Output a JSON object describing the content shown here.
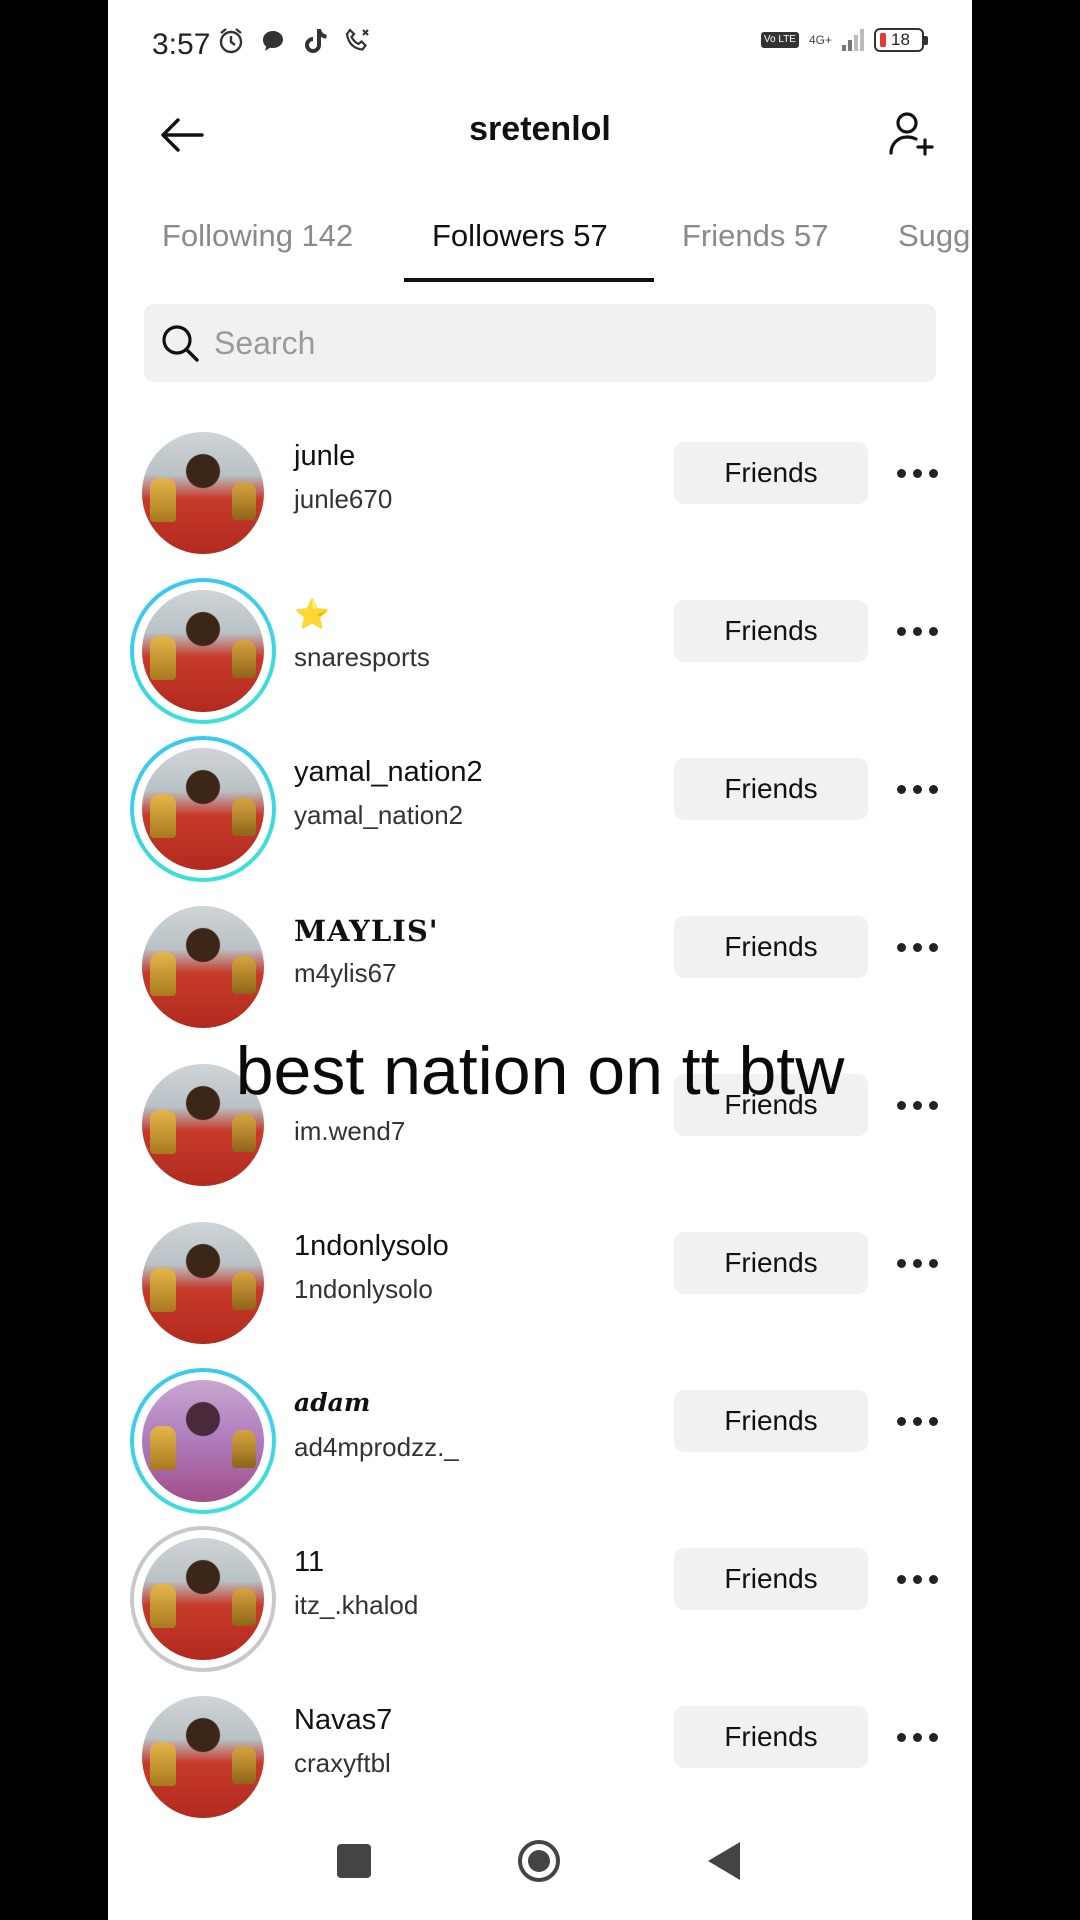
{
  "status_bar": {
    "time": "3:57",
    "icons": [
      "alarm-icon",
      "chat-bubble-icon",
      "tiktok-icon",
      "call-icon"
    ],
    "volte": "Vo LTE",
    "network": "4G+",
    "battery": "18",
    "battery_color": "#e53935"
  },
  "header": {
    "title": "sretenlol"
  },
  "tabs": [
    {
      "label": "Following 142",
      "active": false
    },
    {
      "label": "Followers 57",
      "active": true
    },
    {
      "label": "Friends 57",
      "active": false
    },
    {
      "label": "Sugg",
      "active": false
    }
  ],
  "search": {
    "placeholder": "Search"
  },
  "users": [
    {
      "name": "junle",
      "handle": "junle670",
      "button": "Friends",
      "ring": "none"
    },
    {
      "name": "⭐",
      "handle": "snaresports",
      "button": "Friends",
      "ring": "story"
    },
    {
      "name": "yamal_nation2",
      "handle": "yamal_nation2",
      "button": "Friends",
      "ring": "story"
    },
    {
      "name": "MAYLIS'",
      "handle": "m4ylis67",
      "button": "Friends",
      "ring": "none"
    },
    {
      "name": "",
      "handle": "im.wend7",
      "button": "Friends",
      "ring": "none"
    },
    {
      "name": "1ndonlysolo",
      "handle": "1ndonlysolo",
      "button": "Friends",
      "ring": "none"
    },
    {
      "name": "adam",
      "handle": "ad4mprodzz._",
      "button": "Friends",
      "ring": "story"
    },
    {
      "name": "11",
      "handle": "itz_.khalod",
      "button": "Friends",
      "ring": "seen"
    },
    {
      "name": "Navas7",
      "handle": "craxyftbl",
      "button": "Friends",
      "ring": "none"
    }
  ],
  "caption": "best nation on tt btw",
  "colors": {
    "story_ring_start": "#39c5f3",
    "story_ring_end": "#3fe3d4",
    "button_bg": "#f1f1f2"
  }
}
